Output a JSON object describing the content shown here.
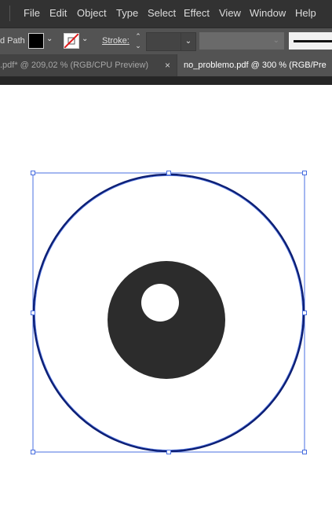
{
  "menu": [
    "File",
    "Edit",
    "Object",
    "Type",
    "Select",
    "Effect",
    "View",
    "Window",
    "Help"
  ],
  "control": {
    "selection_label": "d Path",
    "stroke_label": "Stroke:"
  },
  "tabs": {
    "inactive_label": ".pdf* @ 209,02 % (RGB/CPU Preview)",
    "inactive_close": "×",
    "active_label": "no_problemo.pdf @ 300 % (RGB/Pre"
  },
  "icons": {
    "fill_swatch": "black-fill-swatch",
    "stroke_swatch": "none-stroke-swatch",
    "dropdown": "chevron-down-icon",
    "stepper": "stepper-arrows-icon"
  },
  "colors": {
    "menubar": "#323232",
    "controlbar": "#535353",
    "selection_blue": "#4a6fe0",
    "stroke_navy": "#0d1f73",
    "pupil": "#2c2c2c"
  }
}
